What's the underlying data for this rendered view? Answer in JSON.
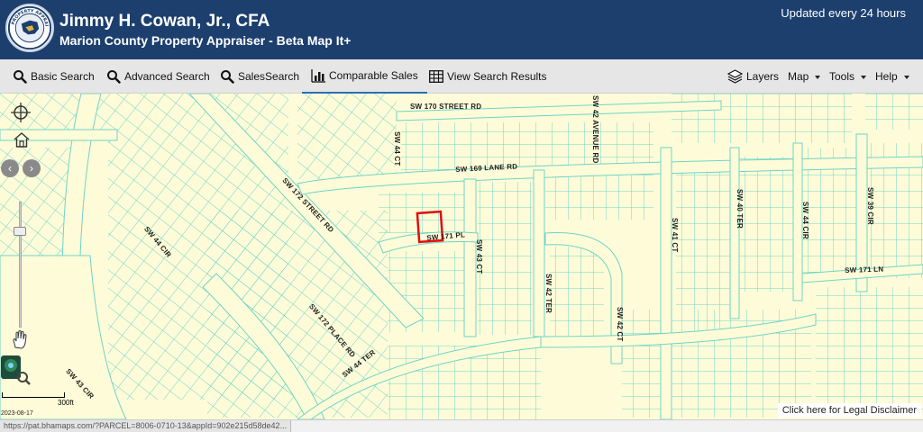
{
  "header": {
    "title": "Jimmy H. Cowan, Jr., CFA",
    "subtitle": "Marion County Property Appraiser - Beta Map It+",
    "updated": "Updated every 24 hours",
    "logo_text": "PROPERTY APPRAISER"
  },
  "toolbar": {
    "left": [
      {
        "label": "Basic Search",
        "icon": "magnifier-icon"
      },
      {
        "label": "Advanced Search",
        "icon": "magnifier-icon"
      },
      {
        "label": "SalesSearch",
        "icon": "magnifier-icon"
      },
      {
        "label": "Comparable Sales",
        "icon": "chart-icon",
        "active": true
      },
      {
        "label": "View Search Results",
        "icon": "grid-icon"
      }
    ],
    "right": [
      {
        "label": "Layers",
        "icon": "layers-icon"
      },
      {
        "label": "Map"
      },
      {
        "label": "Tools"
      },
      {
        "label": "Help"
      }
    ]
  },
  "map": {
    "roads": [
      "SW 170 STREET RD",
      "SW 42 AVENUE RD",
      "SW 44 CT",
      "SW 169 LANE RD",
      "SW 172 STREET RD",
      "SW 171 PL",
      "SW 43 CT",
      "SW 42 TER",
      "SW 41 CT",
      "SW 40 TER",
      "SW 44 CIR",
      "SW 39 CIR",
      "SW 171 LN",
      "SW 42 CT",
      "SW 172 PLACE RD",
      "SW 44 TER",
      "SW 44 CIR",
      "SW 43 CIR"
    ],
    "scale": "300ft",
    "date": "2023-08-17",
    "colors": {
      "background": "#fefcd8",
      "parcel": "#6fd3c8",
      "selected": "#e01010"
    }
  },
  "disclaimer": "Click here for Legal Disclaimer",
  "status_url": "https://pat.bhamaps.com/?PARCEL=8006-0710-13&appId=902e215d58de42..."
}
